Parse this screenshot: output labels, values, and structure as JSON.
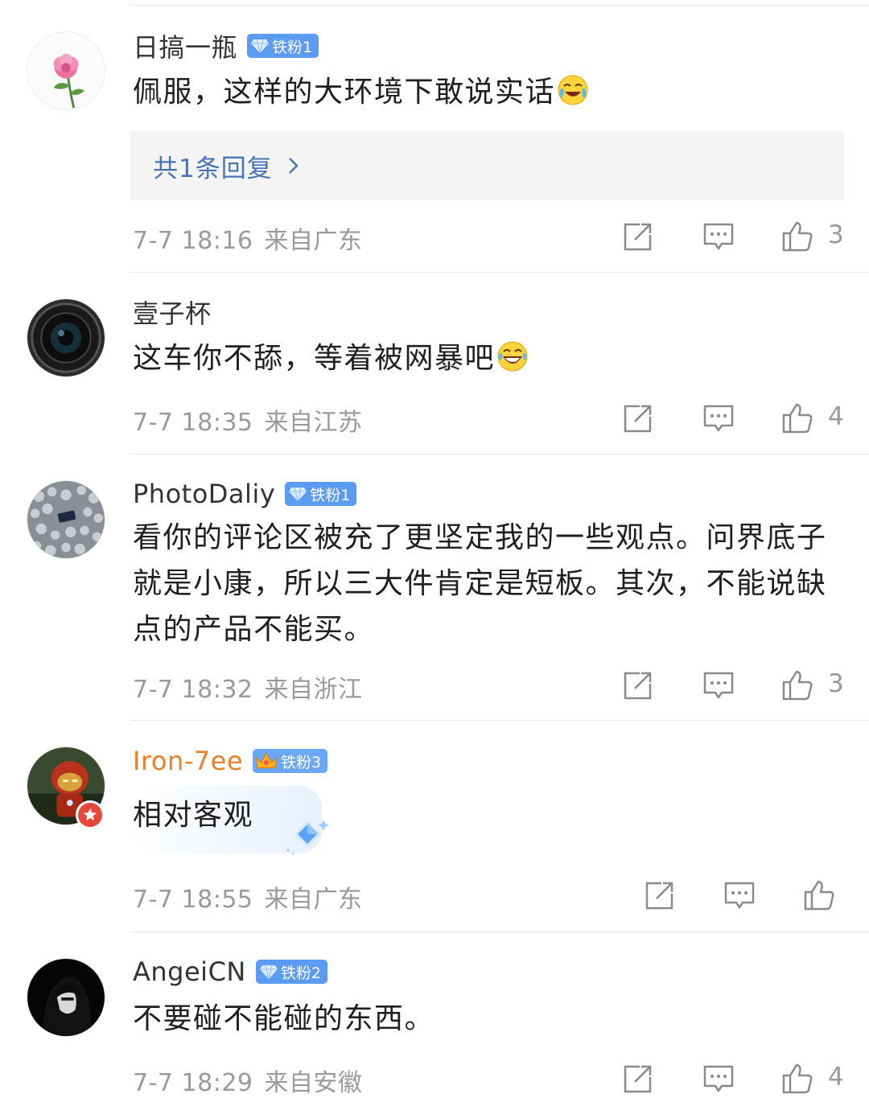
{
  "comments": [
    {
      "username": "日搞一瓶",
      "fan_badge": "铁粉1",
      "text": "佩服，这样的大环境下敢说实话",
      "reply_link": "共1条回复",
      "time": "7-7 18:16",
      "location": "来自广东",
      "likes": "3",
      "avatar_icon": "peony-flower"
    },
    {
      "username": "壹子杯",
      "text": "这车你不舔，等着被网暴吧",
      "time": "7-7 18:35",
      "location": "来自江苏",
      "likes": "4",
      "avatar_icon": "camera-lens"
    },
    {
      "username": "PhotoDaliy",
      "fan_badge": "铁粉1",
      "text": "看你的评论区被充了更坚定我的一些观点。问界底子就是小康，所以三大件肯定是短板。其次，不能说缺点的产品不能买。",
      "time": "7-7 18:32",
      "location": "来自浙江",
      "likes": "3",
      "avatar_icon": "pebbles"
    },
    {
      "username": "Iron-7ee",
      "fan_badge": "铁粉3",
      "text": "相对客观",
      "time": "7-7 18:55",
      "location": "来自广东",
      "likes": "",
      "avatar_icon": "ironman-figure"
    },
    {
      "username": "AngeiCN",
      "fan_badge": "铁粉2",
      "text": "不要碰不能碰的东西。",
      "time": "7-7 18:29",
      "location": "来自安徽",
      "likes": "4",
      "avatar_icon": "hooded-figure"
    }
  ],
  "icons": {
    "share": "share-icon",
    "comment": "comment-icon",
    "like": "thumbs-up-icon",
    "emoji_1": "laugh-cry-emoji",
    "emoji_2": "laugh-emoji"
  },
  "colors": {
    "username": "#333333",
    "username_vip": "#e8802a",
    "link": "#4a74b0",
    "meta": "#9a9a9a",
    "fan_badge": "#5b9cf2",
    "reply_bg": "#f4f4f4"
  }
}
